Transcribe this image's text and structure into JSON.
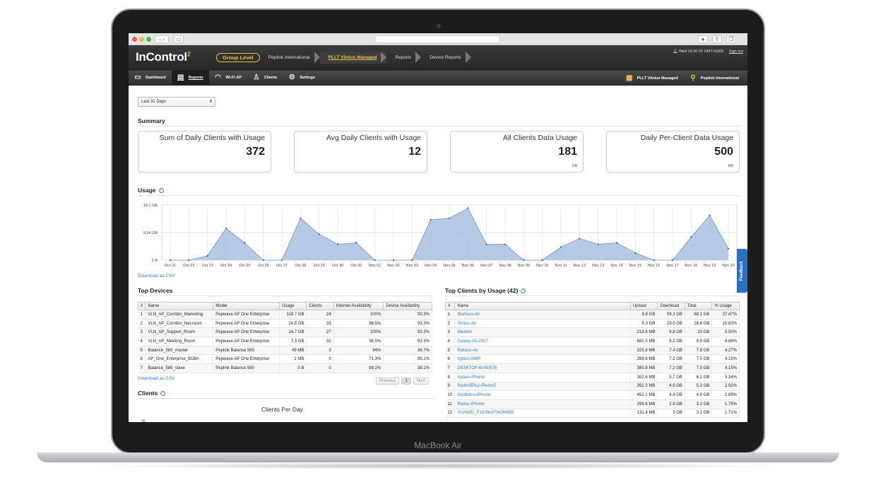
{
  "device": {
    "label": "MacBook Air"
  },
  "app": {
    "logo": "InControl",
    "logo_sup": "2",
    "breadcrumbs": [
      "Group Level",
      "Peplink International",
      "PLLT Vilnius Managed",
      "Reports",
      "Device Reports"
    ],
    "datetime": "Wed 16:30:00 GMT+0200",
    "signout": "Sign out"
  },
  "nav": {
    "items": [
      {
        "label": "Dashboard",
        "icon": "monitor-icon"
      },
      {
        "label": "Reports",
        "icon": "document-icon"
      },
      {
        "label": "Wi-Fi AP",
        "icon": "wifi-icon"
      },
      {
        "label": "Clients",
        "icon": "user-icon"
      },
      {
        "label": "Settings",
        "icon": "gear-icon"
      }
    ],
    "right": [
      {
        "label": "PLLT Vilnius Managed",
        "icon": "grid-icon"
      },
      {
        "label": "Peplink International",
        "icon": "org-icon"
      }
    ]
  },
  "filter": {
    "range": "Last 31 Days"
  },
  "summary": {
    "heading": "Summary",
    "cards": [
      {
        "title": "Sum of Daily Clients with Usage",
        "value": "372",
        "unit": ""
      },
      {
        "title": "Avg Daily Clients with Usage",
        "value": "12",
        "unit": ""
      },
      {
        "title": "All Clients Data Usage",
        "value": "181",
        "unit": "GB"
      },
      {
        "title": "Daily Per-Client Data Usage",
        "value": "500",
        "unit": "MB"
      }
    ]
  },
  "usage": {
    "heading": "Usage",
    "download": "Download as CSV"
  },
  "chart_data": {
    "type": "area",
    "title": "",
    "xlabel": "",
    "ylabel": "",
    "y_ticks": [
      "0 B",
      "9.54 GB",
      "19.1 GB"
    ],
    "ylim": [
      0,
      19.1
    ],
    "grid": true,
    "color": "#a8c1df",
    "line_color": "#6f95c4",
    "categories": [
      "Oct 21",
      "Oct 22",
      "Oct 23",
      "Oct 24",
      "Oct 25",
      "Oct 26",
      "Oct 27",
      "Oct 28",
      "Oct 29",
      "Oct 30",
      "Oct 31",
      "Nov 01",
      "Nov 02",
      "Nov 03",
      "Nov 04",
      "Nov 05",
      "Nov 06",
      "Nov 07",
      "Nov 08",
      "Nov 09",
      "Nov 10",
      "Nov 11",
      "Nov 12",
      "Nov 13",
      "Nov 14",
      "Nov 15",
      "Nov 16",
      "Nov 17",
      "Nov 18",
      "Nov 19",
      "Nov 20"
    ],
    "values": [
      0,
      0,
      1.5,
      11,
      6,
      0,
      0,
      14.5,
      9,
      5.5,
      6,
      0,
      0,
      0,
      14,
      14.5,
      18,
      5.5,
      5.5,
      0,
      0,
      4.5,
      7.5,
      5.5,
      6,
      2.5,
      0,
      0,
      8,
      15.5,
      4
    ]
  },
  "top_devices": {
    "heading": "Top Devices",
    "columns": [
      "#",
      "Name",
      "Model",
      "Usage",
      "Clients",
      "Internet Availability",
      "Device Availability"
    ],
    "rows": [
      [
        "1",
        "VLN_AP_Corridor_Marketing",
        "Pepwave AP One Enterprise",
        "118.7 GB",
        "24",
        "100%",
        "93.3%"
      ],
      [
        "2",
        "VLN_AP_Corridor_Net-room",
        "Pepwave AP One Enterprise",
        "24.8 GB",
        "33",
        "98.5%",
        "93.3%"
      ],
      [
        "3",
        "VLN_AP_Support_Room",
        "Pepwave AP One Enterprise",
        "14.7 GB",
        "27",
        "100%",
        "93.3%"
      ],
      [
        "4",
        "VLN_AP_Meeting_Room",
        "Pepwave AP One Enterprise",
        "7.3 GB",
        "32",
        "98.5%",
        "93.3%"
      ],
      [
        "5",
        "Balance_580_master",
        "Peplink Balance 580",
        "49 MB",
        "3",
        "94%",
        "36.7%"
      ],
      [
        "6",
        "AP_One_Enterprise_B1BA",
        "Pepwave AP One Enterprise",
        "1 MB",
        "0",
        "71.3%",
        "85.1%"
      ],
      [
        "7",
        "Balance_580_slave",
        "Peplink Balance 580",
        "0 B",
        "0",
        "89.2%",
        "38.1%"
      ]
    ],
    "download": "Download as CSV",
    "pager": {
      "prev": "Previous",
      "page": "1",
      "next": "Next"
    }
  },
  "clients": {
    "heading": "Clients",
    "chart_title": "Clients Per Day",
    "y_top": "30"
  },
  "top_clients": {
    "heading": "Top Clients by Usage (42)",
    "columns": [
      "#",
      "Name",
      "Upload",
      "Download",
      "Total",
      "% Usage"
    ],
    "rows": [
      [
        "1",
        "Mantass-Air",
        "8.8 GB",
        "59.3 GB",
        "68.1 GB",
        "37.47%"
      ],
      [
        "2",
        "Gintes-Air",
        "5.3 GB",
        "23.5 GB",
        "28.8 GB",
        "15.83%"
      ],
      [
        "3",
        "Gedsim",
        "218.6 MB",
        "9.8 GB",
        "10 GB",
        "5.50%"
      ],
      [
        "4",
        "Galaxy-A5-2017",
        "682.5 MB",
        "8.2 GB",
        "8.9 GB",
        "4.88%"
      ],
      [
        "5",
        "Rokass-Air",
        "325.8 MB",
        "7.4 GB",
        "7.8 GB",
        "4.27%"
      ],
      [
        "6",
        "Vytass-MBP",
        "283.6 MB",
        "7.3 GB",
        "7.5 GB",
        "4.15%"
      ],
      [
        "7",
        "DESKTOP-6U0D576",
        "380.8 MB",
        "7.2 GB",
        "7.5 GB",
        "4.15%"
      ],
      [
        "8",
        "Vytass-iPhone",
        "352.6 MB",
        "5.7 GB",
        "6.1 GB",
        "3.34%"
      ],
      [
        "9",
        "Redmi5Plus-Redmi5",
        "392.3 MB",
        "4.9 GB",
        "5.3 GB",
        "2.92%"
      ],
      [
        "10",
        "GediminssiPhone",
        "452.1 MB",
        "4.4 GB",
        "4.9 GB",
        "2.69%"
      ],
      [
        "11",
        "Redas-iPhone",
        "299.8 MB",
        "2.9 GB",
        "3.2 GB",
        "1.75%"
      ],
      [
        "12",
        "HUAWEI_P10-f9c373e0f4658",
        "131.4 MB",
        "3 GB",
        "3.1 GB",
        "1.71%"
      ]
    ]
  },
  "feedback": "Feedback"
}
